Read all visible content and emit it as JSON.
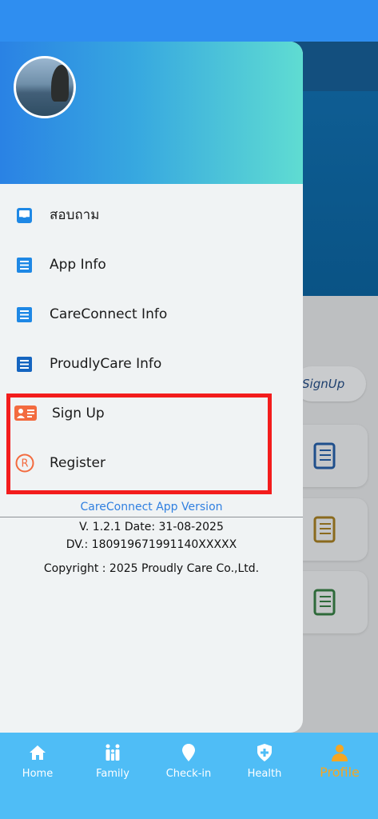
{
  "status_bar": {
    "ghost_text": ""
  },
  "background": {
    "signup_label": "SignUp"
  },
  "drawer": {
    "menu": [
      {
        "label": "สอบถาม",
        "icon": "inbox-icon"
      },
      {
        "label": "App Info",
        "icon": "document-icon"
      },
      {
        "label": "CareConnect Info",
        "icon": "document-icon"
      },
      {
        "label": "ProudlyCare Info",
        "icon": "document-icon"
      },
      {
        "label": "Sign Up",
        "icon": "id-card-icon"
      },
      {
        "label": "Register",
        "icon": "registered-icon"
      }
    ],
    "version_title": "CareConnect App Version",
    "version_line": "V. 1.2.1    Date: 31-08-2025",
    "dv_line": "DV.: 180919671991140XXXXX",
    "copyright": "Copyright : 2025 Proudly Care Co.,Ltd."
  },
  "bottom_nav": [
    {
      "label": "Home",
      "icon": "home-icon"
    },
    {
      "label": "Family",
      "icon": "family-icon"
    },
    {
      "label": "Check-in",
      "icon": "location-pin-icon"
    },
    {
      "label": "Health",
      "icon": "shield-plus-icon"
    },
    {
      "label": "Profile",
      "icon": "user-icon",
      "active": true
    }
  ],
  "colors": {
    "accent": "#2f8ef0",
    "highlight_border": "#f31c1c",
    "active_tab": "#f5a623",
    "nav_bg": "#4fbdf6"
  }
}
